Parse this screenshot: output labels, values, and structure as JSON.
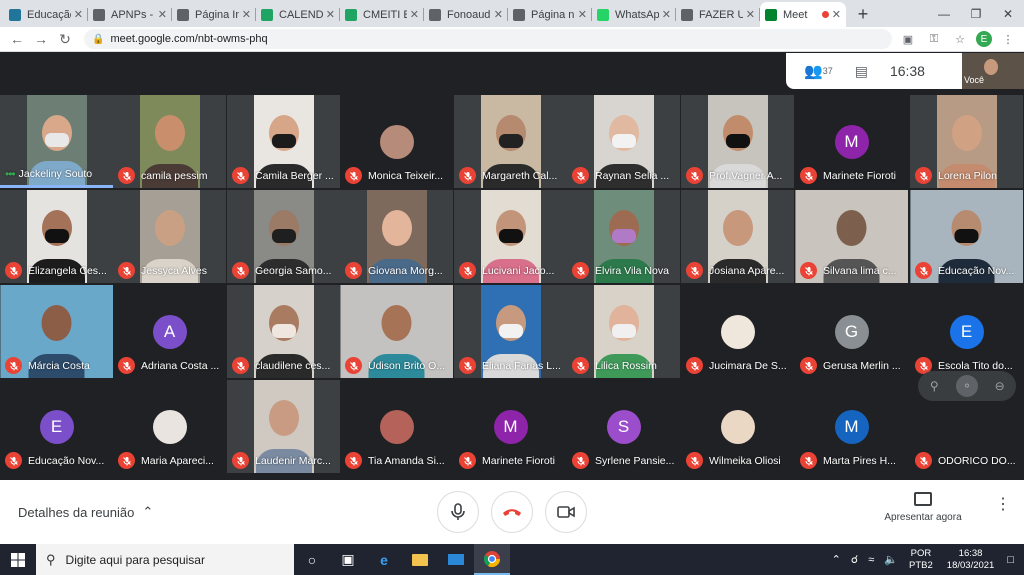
{
  "browser": {
    "tabs": [
      {
        "label": "Educação",
        "fav": "#21759b",
        "icon": "wordpress-icon"
      },
      {
        "label": "APNPs -",
        "fav": "#5f6368",
        "icon": "site-icon"
      },
      {
        "label": "Página In",
        "fav": "#5f6368",
        "icon": "site-icon"
      },
      {
        "label": "CALENDÁ",
        "fav": "#1fa463",
        "icon": "google-drive-icon"
      },
      {
        "label": "CMEITI E",
        "fav": "#1fa463",
        "icon": "google-drive-icon"
      },
      {
        "label": "Fonoaudi",
        "fav": "#5f6368",
        "icon": "site-icon"
      },
      {
        "label": "Página n",
        "fav": "#5f6368",
        "icon": "site-icon"
      },
      {
        "label": "WhatsAp",
        "fav": "#25d366",
        "icon": "whatsapp-icon"
      },
      {
        "label": "FAZER UF",
        "fav": "#5f6368",
        "icon": "site-icon"
      },
      {
        "label": "Meet",
        "fav": "#00832d",
        "icon": "google-meet-icon",
        "active": true
      }
    ],
    "url": "meet.google.com/nbt-owms-phq",
    "profile_initial": "E"
  },
  "meet": {
    "participant_count": "37",
    "time": "16:38",
    "self_label": "Você",
    "details_label": "Detalhes da reunião",
    "present_label": "Apresentar agora"
  },
  "participants": [
    {
      "name": "Jackeliny Souto",
      "kind": "video",
      "bg": "#6d7f74",
      "skin": "#d9a88a",
      "mask": "#e8e8e8",
      "shirt": "#7fa9c9",
      "speaking": true
    },
    {
      "name": "camila pessim",
      "kind": "video",
      "bg": "#7e8a5a",
      "skin": "#c98f6d",
      "shirt": "#4a3b36"
    },
    {
      "name": "Camila Berger ...",
      "kind": "video",
      "bg": "#e9e6e2",
      "skin": "#d7a588",
      "mask": "#1b1b1b",
      "shirt": "#2a2a2a"
    },
    {
      "name": "Monica Teixeir...",
      "kind": "photo",
      "bg": "#b78b7a"
    },
    {
      "name": "Margareth Cal...",
      "kind": "video",
      "bg": "#c9b8a2",
      "skin": "#b68a6f",
      "mask": "#222",
      "shirt": "#2b2b2b"
    },
    {
      "name": "Raynan Selia ...",
      "kind": "video",
      "bg": "#d8d4cf",
      "skin": "#e1b9a0",
      "mask": "#f2f2f2",
      "shirt": "#2e2e2e"
    },
    {
      "name": "Prof.Vagner A...",
      "kind": "video",
      "bg": "#c7c3bd",
      "skin": "#c18c6b",
      "mask": "#111",
      "shirt": "#d9d9d9"
    },
    {
      "name": "Marinete Fioroti",
      "kind": "avatar",
      "letter": "M",
      "color": "#8e24aa"
    },
    {
      "name": "Lorena Pilon",
      "kind": "video",
      "bg": "#b79b84",
      "skin": "#d1a184",
      "shirt": "#c48b6e"
    },
    {
      "name": "Elizangela Ces...",
      "kind": "video",
      "bg": "#e5e3e0",
      "skin": "#a37258",
      "mask": "#111",
      "shirt": "#1c1c1c"
    },
    {
      "name": "Jessyca Alves",
      "kind": "video",
      "bg": "#a69f96",
      "skin": "#caa084",
      "shirt": "#d9d3c9"
    },
    {
      "name": "Georgia Samo...",
      "kind": "video",
      "bg": "#8a8a87",
      "skin": "#9b7a66",
      "mask": "#1f1f1f",
      "shirt": "#2d2d2d"
    },
    {
      "name": "Giovana Morg...",
      "kind": "video",
      "bg": "#7e6a5c",
      "skin": "#e3b59a",
      "shirt": "#4a6a8a"
    },
    {
      "name": "Lucivani Jaco...",
      "kind": "video",
      "bg": "#e3dcd3",
      "skin": "#c2957a",
      "mask": "#111",
      "shirt": "#d86f8b"
    },
    {
      "name": "Elvira Vila Nova",
      "kind": "video",
      "bg": "#6e8e7b",
      "skin": "#9d6a52",
      "mask": "#b07ac7",
      "shirt": "#2c7a4b"
    },
    {
      "name": "Josiana Apare...",
      "kind": "video",
      "bg": "#d5d0c8",
      "skin": "#c7987c",
      "shirt": "#2a2a2a"
    },
    {
      "name": "Silvana lima c...",
      "kind": "video",
      "bg": "#c9c4bd",
      "skin": "#7d5f4d",
      "shirt": "#555",
      "wide": true
    },
    {
      "name": "Educação Nov...",
      "kind": "video",
      "bg": "#a8b5bf",
      "skin": "#b78b70",
      "mask": "#111",
      "shirt": "#1e2b3a",
      "wide": true
    },
    {
      "name": "Márcia Costa",
      "kind": "video",
      "bg": "#6aa8c9",
      "skin": "#8c5e48",
      "shirt": "#2d4b6b",
      "wide": true
    },
    {
      "name": "Adriana Costa ...",
      "kind": "avatar",
      "letter": "A",
      "color": "#7b4fc9"
    },
    {
      "name": "claudilene ces...",
      "kind": "video",
      "bg": "#d6d1ca",
      "skin": "#a97b61",
      "mask": "#f0e6e0",
      "shirt": "#2a2a2a"
    },
    {
      "name": "Udison Brito O...",
      "kind": "video",
      "bg": "#c4c2c0",
      "skin": "#a77356",
      "shirt": "#2c8a9a",
      "wide": true
    },
    {
      "name": "Eliana Farias L...",
      "kind": "video",
      "bg": "#2f6fb3",
      "skin": "#c79a7f",
      "mask": "#f2f2f2",
      "shirt": "#d9d9d9"
    },
    {
      "name": "Lilica Rossim",
      "kind": "video",
      "bg": "#d8d2c8",
      "skin": "#e0b39a",
      "mask": "#f0f0f0",
      "shirt": "#3f9a5a"
    },
    {
      "name": "Jucimara De S...",
      "kind": "photo",
      "bg": "#efe7dc"
    },
    {
      "name": "Gerusa Merlin ...",
      "kind": "avatar",
      "letter": "G",
      "color": "#8a8f94"
    },
    {
      "name": "Escola Tito do...",
      "kind": "avatar",
      "letter": "E",
      "color": "#1a73e8"
    },
    {
      "name": "Educação Nov...",
      "kind": "avatar",
      "letter": "E",
      "color": "#7b4fc9"
    },
    {
      "name": "Maria Apareci...",
      "kind": "photo",
      "bg": "#e9e4df"
    },
    {
      "name": "Laudenir Marc...",
      "kind": "video",
      "bg": "#cfc9c2",
      "skin": "#c99b82",
      "shirt": "#7a8aa0"
    },
    {
      "name": "Tia Amanda Si...",
      "kind": "photo",
      "bg": "#b5635a"
    },
    {
      "name": "Marinete Fioroti",
      "kind": "avatar",
      "letter": "M",
      "color": "#8e24aa"
    },
    {
      "name": "Syrlene Pansie...",
      "kind": "avatar",
      "letter": "S",
      "color": "#9c4dcc"
    },
    {
      "name": "Wilmeika Oliosi",
      "kind": "photo",
      "bg": "#ead8c5"
    },
    {
      "name": "Marta Pires H...",
      "kind": "avatar",
      "letter": "M",
      "color": "#1565c0"
    },
    {
      "name": "ODORICO DO...",
      "kind": "blank"
    }
  ],
  "taskbar": {
    "search_placeholder": "Digite aqui para pesquisar",
    "lang_top": "POR",
    "lang_bottom": "PTB2",
    "clock_time": "16:38",
    "clock_date": "18/03/2021"
  }
}
